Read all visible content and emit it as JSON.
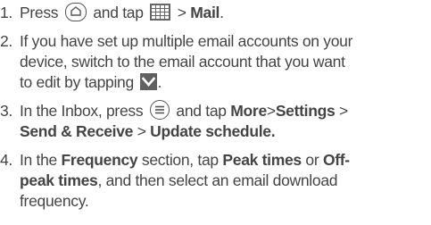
{
  "steps": [
    {
      "number": "1.",
      "parts": {
        "press": "Press",
        "and_tap": "and tap",
        "arrow": ">",
        "mail": "Mail",
        "period": "."
      },
      "icons": [
        "home-button-icon",
        "all-apps-grid-icon"
      ]
    },
    {
      "number": "2.",
      "lines": [
        "If you have set up multiple email accounts on your",
        "device, switch to the email account that you want",
        "to edit by tapping"
      ],
      "period": ".",
      "icons": [
        "dropdown-check-icon"
      ]
    },
    {
      "number": "3.",
      "parts": {
        "in_inbox_press": "In the Inbox, press",
        "and_tap": "and tap",
        "more": "More",
        "arrow1": ">",
        "settings": "Settings",
        "arrow2": ">",
        "send_receive": "Send & Receive",
        "arrow3": ">",
        "update_schedule": "Update schedule."
      },
      "icons": [
        "menu-button-icon"
      ]
    },
    {
      "number": "4.",
      "parts": {
        "in_the": "In the",
        "frequency": "Frequency",
        "section_tap": "section, tap",
        "peak_times": "Peak times",
        "or": "or",
        "off": "Off-",
        "peak_times2": "peak times",
        "rest": ", and then select an email download",
        "frequency_word": "frequency."
      }
    }
  ]
}
